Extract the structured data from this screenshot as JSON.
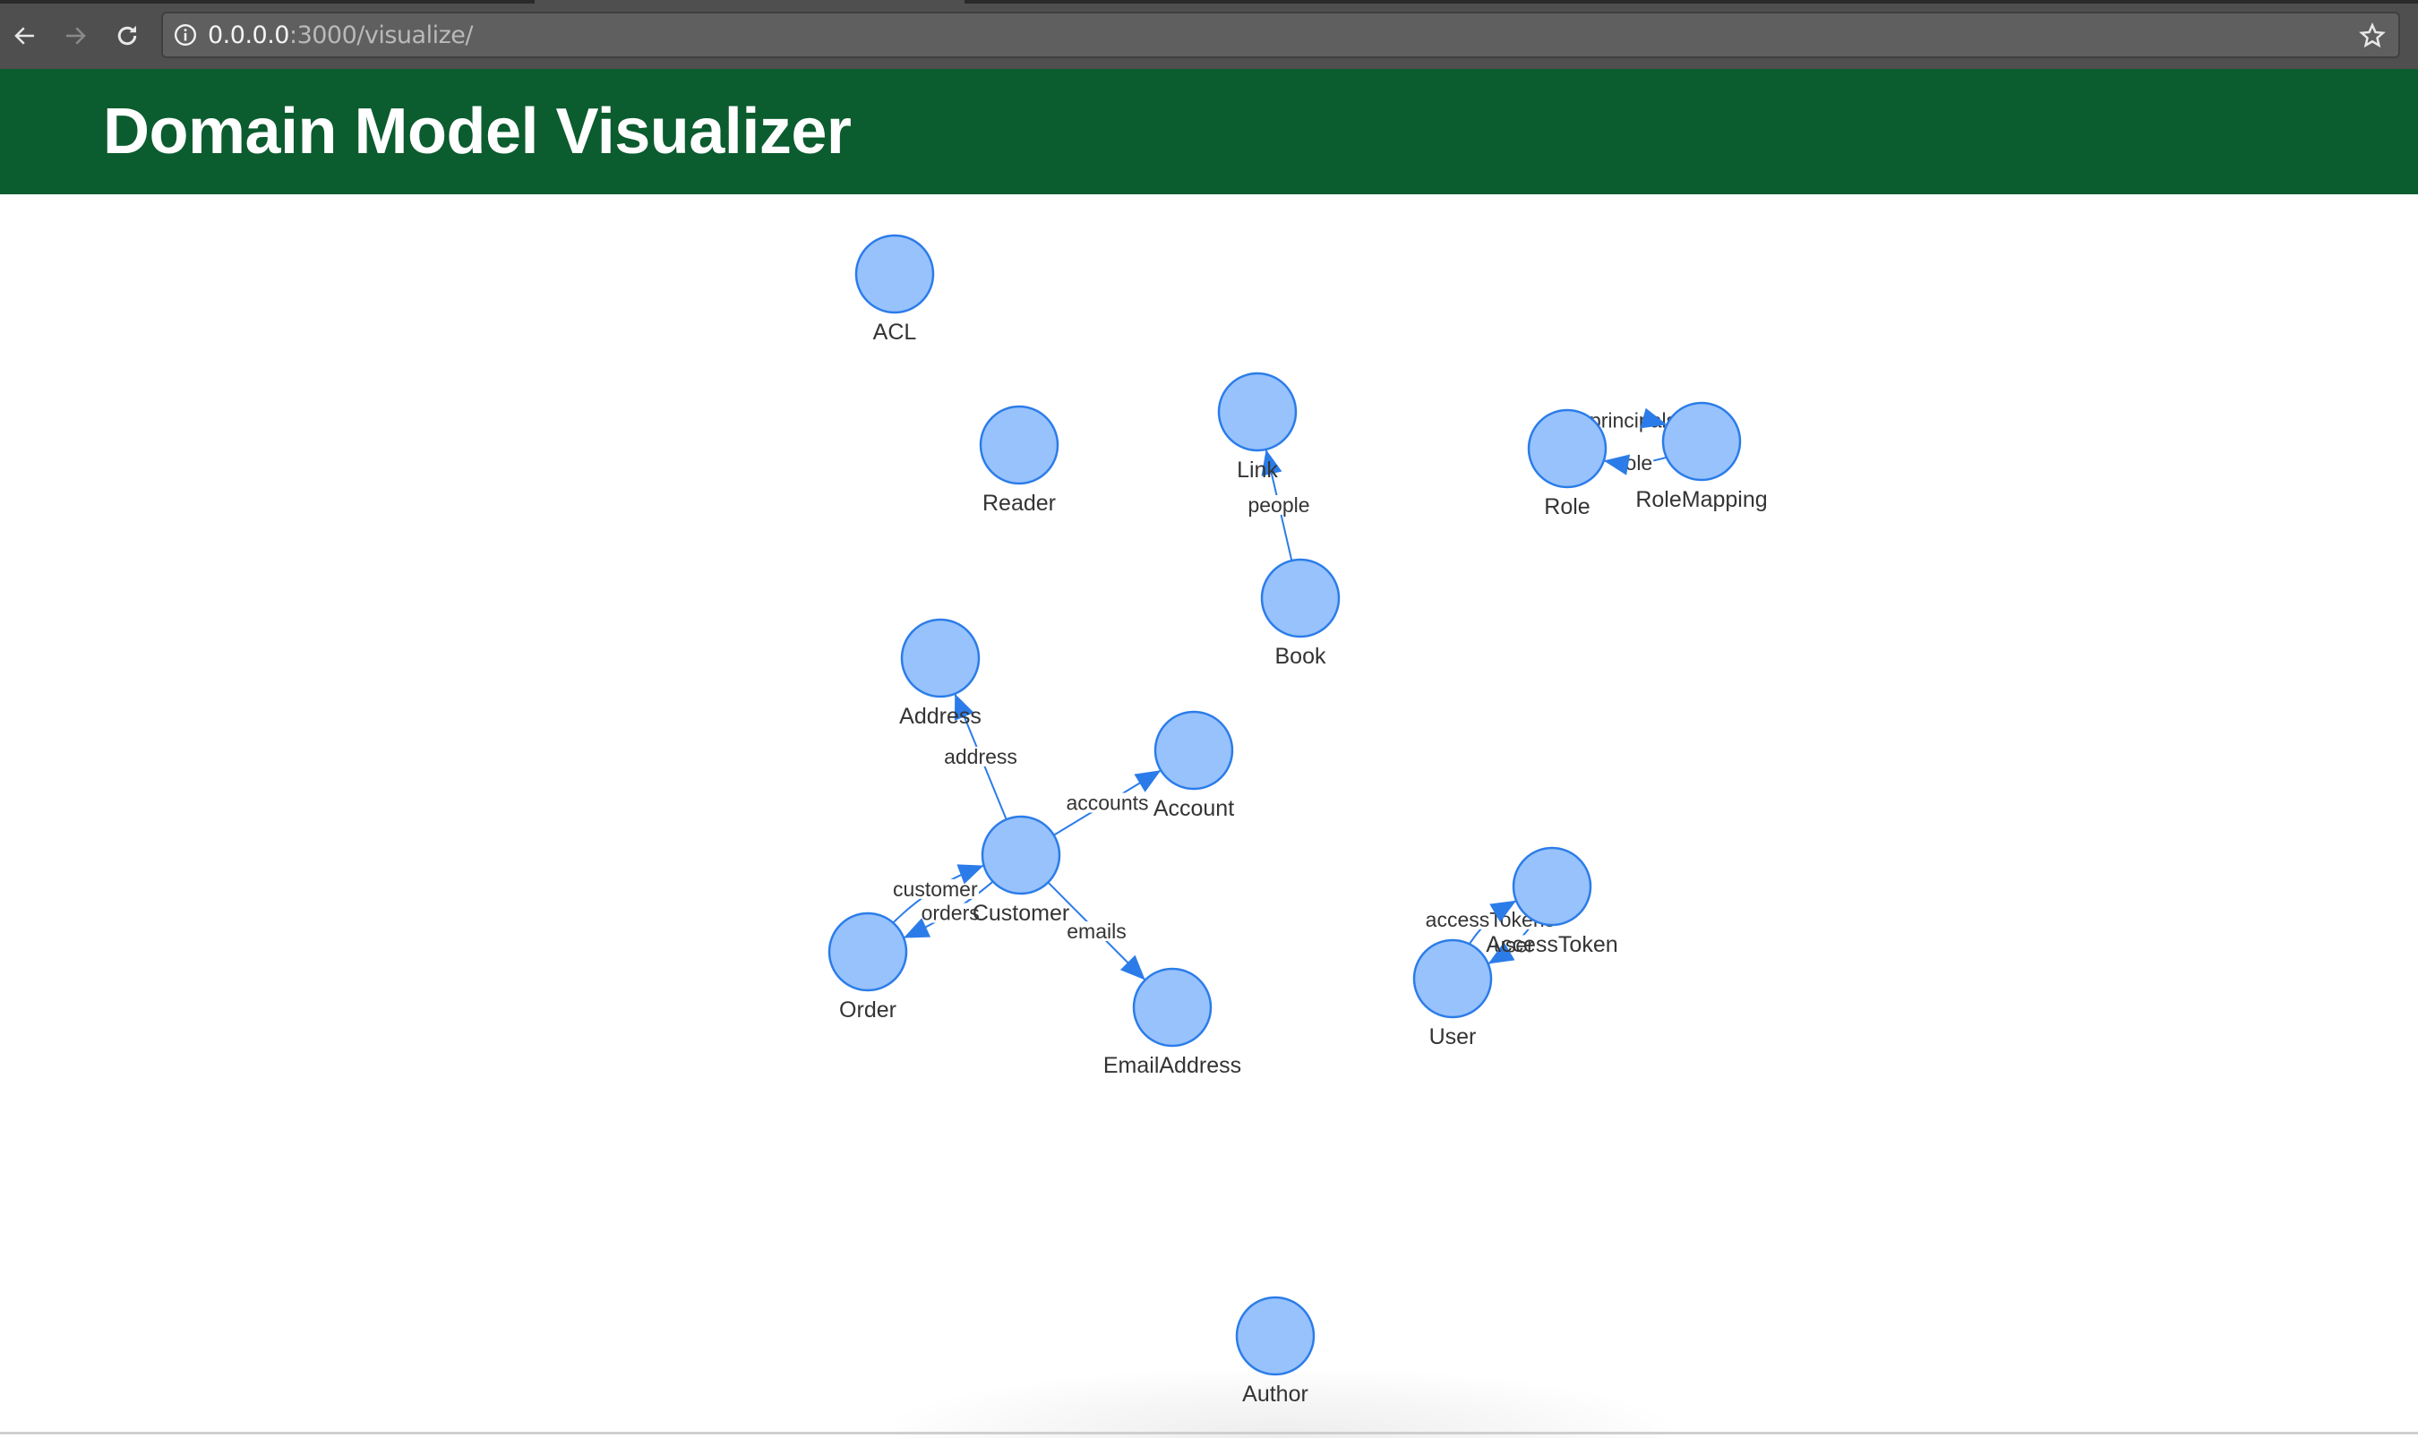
{
  "browser": {
    "url_host": "0.0.0.0",
    "url_rest": ":3000/visualize/",
    "back_icon": "arrow-left-icon",
    "forward_icon": "arrow-right-icon",
    "reload_icon": "reload-icon",
    "info_icon": "info-icon",
    "bookmark_icon": "star-icon"
  },
  "header": {
    "title": "Domain Model Visualizer",
    "background": "#0b5c2e"
  },
  "graph": {
    "node_fill": "#97c2fc",
    "node_border": "#2b7ce9",
    "edge_color": "#2b7ce9",
    "nodes": [
      {
        "id": "ACL",
        "label": "ACL"
      },
      {
        "id": "Reader",
        "label": "Reader"
      },
      {
        "id": "Link",
        "label": "Link"
      },
      {
        "id": "Book",
        "label": "Book"
      },
      {
        "id": "Role",
        "label": "Role"
      },
      {
        "id": "RoleMapping",
        "label": "RoleMapping"
      },
      {
        "id": "Address",
        "label": "Address"
      },
      {
        "id": "Account",
        "label": "Account"
      },
      {
        "id": "Customer",
        "label": "Customer"
      },
      {
        "id": "Order",
        "label": "Order"
      },
      {
        "id": "EmailAddress",
        "label": "EmailAddress"
      },
      {
        "id": "AccessToken",
        "label": "AccessToken"
      },
      {
        "id": "User",
        "label": "User"
      },
      {
        "id": "Author",
        "label": "Author"
      }
    ],
    "edges": [
      {
        "from": "Book",
        "to": "Link",
        "label": "people"
      },
      {
        "from": "Role",
        "to": "RoleMapping",
        "label": "principals"
      },
      {
        "from": "RoleMapping",
        "to": "Role",
        "label": "role"
      },
      {
        "from": "Customer",
        "to": "Address",
        "label": "address"
      },
      {
        "from": "Customer",
        "to": "Account",
        "label": "accounts"
      },
      {
        "from": "Order",
        "to": "Customer",
        "label": "customer"
      },
      {
        "from": "Customer",
        "to": "Order",
        "label": "orders"
      },
      {
        "from": "Customer",
        "to": "EmailAddress",
        "label": "emails"
      },
      {
        "from": "User",
        "to": "AccessToken",
        "label": "accessTokens"
      },
      {
        "from": "AccessToken",
        "to": "User",
        "label": "user"
      }
    ]
  }
}
